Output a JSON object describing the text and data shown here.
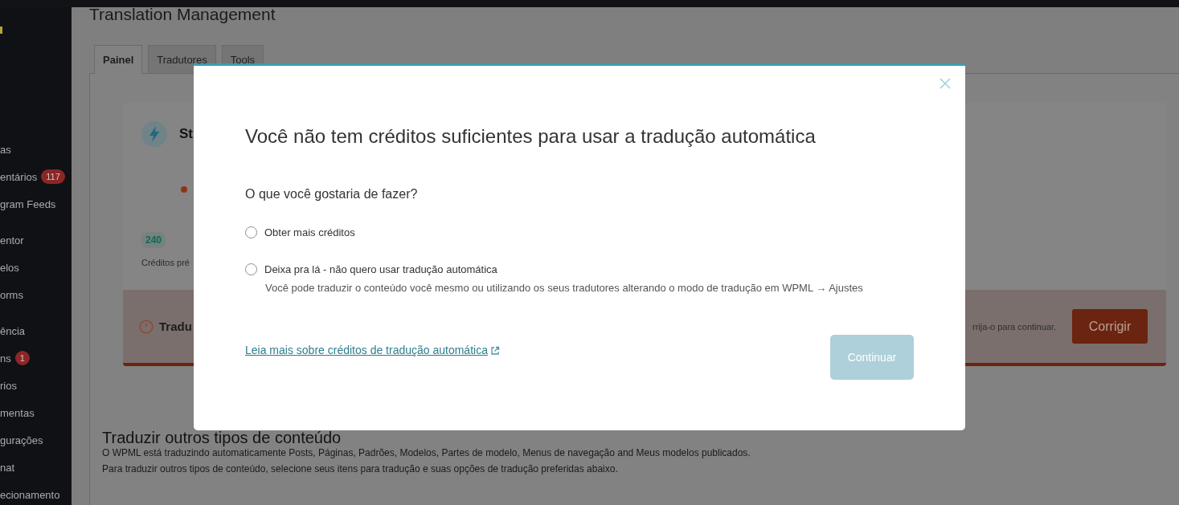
{
  "sidebar": {
    "groups": [
      {
        "items": [
          {
            "label": "as"
          },
          {
            "label": "entários",
            "badge": "117"
          },
          {
            "label": "gram Feeds"
          }
        ]
      },
      {
        "items": [
          {
            "label": "entor"
          },
          {
            "label": "elos"
          },
          {
            "label": "orms"
          }
        ]
      },
      {
        "items": [
          {
            "label": "ência"
          },
          {
            "label": "ns",
            "badge": "1"
          },
          {
            "label": "rios"
          },
          {
            "label": "mentas"
          },
          {
            "label": "gurações"
          },
          {
            "label": "nat"
          },
          {
            "label": "ecionamento"
          }
        ]
      }
    ]
  },
  "page": {
    "title": "Translation Management",
    "tabs": [
      {
        "label": "Painel",
        "selected": true
      },
      {
        "label": "Tradutores",
        "selected": false
      },
      {
        "label": "Tools",
        "selected": false
      }
    ],
    "status_card": {
      "title": "St",
      "credits": "240",
      "credits_label": "Créditos pré",
      "error": {
        "title": "Tradu",
        "message": "rrija-o para continuar.",
        "button": "Corrigir"
      }
    },
    "other_content": {
      "heading": "Traduzir outros tipos de conteúdo",
      "lines": [
        "O WPML está traduzindo automaticamente Posts, Páginas, Padrões, Modelos, Partes de modelo, Menus de navegação and Meus modelos publicados.",
        "Para traduzir outros tipos de conteúdo, selecione seus itens para tradução e suas opções de tradução preferidas abaixo."
      ]
    }
  },
  "modal": {
    "title": "Você não tem créditos suficientes para usar a tradução automática",
    "question": "O que você gostaria de fazer?",
    "options": [
      {
        "label": "Obter mais créditos",
        "selected": false
      },
      {
        "label": "Deixa pra lá - não quero usar tradução automática",
        "description": "Você pode traduzir o conteúdo você mesmo ou utilizando os seus tradutores alterando o modo de tradução em WPML → Ajustes",
        "selected": false
      }
    ],
    "link": "Leia mais sobre créditos de tradução automática",
    "button": {
      "label": "Continuar",
      "disabled": true
    }
  }
}
